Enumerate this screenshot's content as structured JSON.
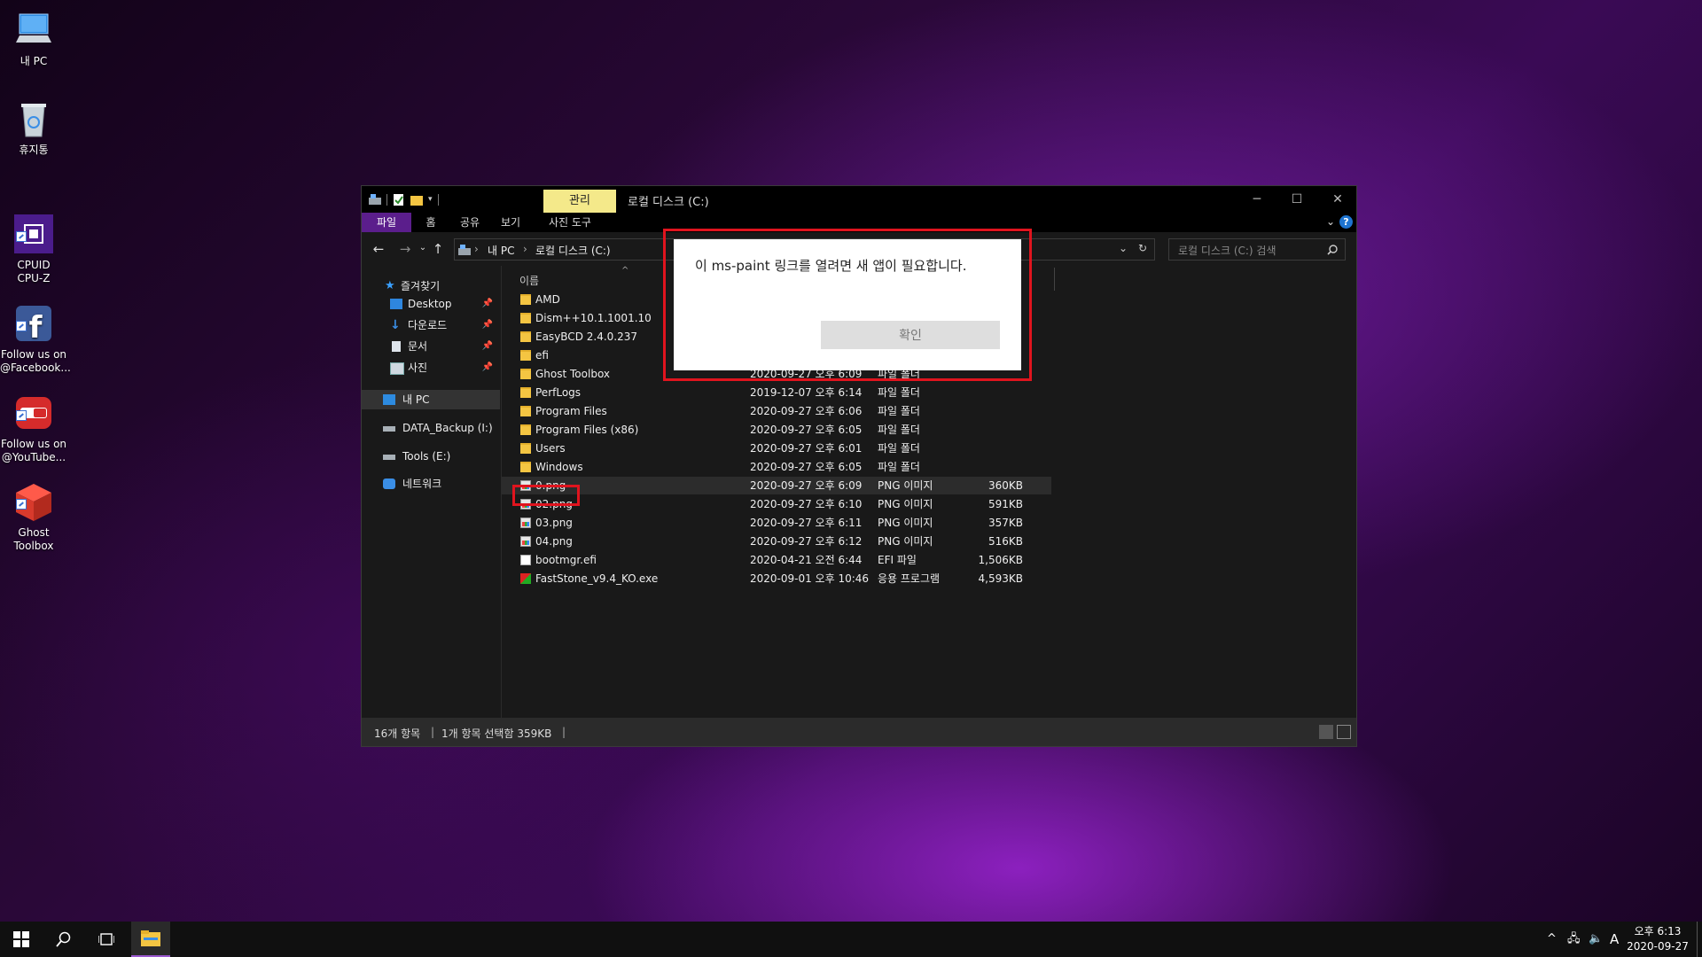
{
  "desktop_icons": [
    {
      "label": "내 PC",
      "icon": "computer-icon"
    },
    {
      "label": "휴지통",
      "icon": "recycle-bin-icon"
    },
    {
      "label": "CPUID\nCPU-Z",
      "icon": "cpuz-icon"
    },
    {
      "label": "Follow us on\n@Facebook...",
      "icon": "facebook-icon"
    },
    {
      "label": "Follow us on\n@YouTube...",
      "icon": "youtube-icon"
    },
    {
      "label": "Ghost\nToolbox",
      "icon": "ghost-toolbox-icon"
    }
  ],
  "explorer": {
    "context_tab": "관리",
    "title": "로컬 디스크 (C:)",
    "ribbon_tabs": [
      "파일",
      "홈",
      "공유",
      "보기",
      "사진 도구"
    ],
    "address": {
      "root": "내 PC",
      "sep": "›",
      "current": "로컬 디스크 (C:)"
    },
    "search_placeholder": "로컬 디스크 (C:) 검색",
    "nav": {
      "quick_access": "즐겨찾기",
      "pinned": [
        "Desktop",
        "다운로드",
        "문서",
        "사진"
      ],
      "this_pc": "내 PC",
      "drives": [
        "DATA_Backup (I:)",
        "Tools (E:)"
      ],
      "network": "네트워크"
    },
    "column_name": "이름",
    "files": [
      {
        "name": "AMD",
        "date": "",
        "type": "",
        "size": "",
        "kind": "folder"
      },
      {
        "name": "Dism++10.1.1001.10",
        "date": "",
        "type": "",
        "size": "",
        "kind": "folder"
      },
      {
        "name": "EasyBCD 2.4.0.237",
        "date": "",
        "type": "",
        "size": "",
        "kind": "folder"
      },
      {
        "name": "efi",
        "date": "",
        "type": "",
        "size": "",
        "kind": "folder"
      },
      {
        "name": "Ghost Toolbox",
        "date": "2020-09-27 오후 6:09",
        "type": "파일 폴더",
        "size": "",
        "kind": "folder"
      },
      {
        "name": "PerfLogs",
        "date": "2019-12-07 오후 6:14",
        "type": "파일 폴더",
        "size": "",
        "kind": "folder"
      },
      {
        "name": "Program Files",
        "date": "2020-09-27 오후 6:06",
        "type": "파일 폴더",
        "size": "",
        "kind": "folder"
      },
      {
        "name": "Program Files (x86)",
        "date": "2020-09-27 오후 6:05",
        "type": "파일 폴더",
        "size": "",
        "kind": "folder"
      },
      {
        "name": "Users",
        "date": "2020-09-27 오후 6:01",
        "type": "파일 폴더",
        "size": "",
        "kind": "folder"
      },
      {
        "name": "Windows",
        "date": "2020-09-27 오후 6:05",
        "type": "파일 폴더",
        "size": "",
        "kind": "folder"
      },
      {
        "name": "0.png",
        "date": "2020-09-27 오후 6:09",
        "type": "PNG 이미지",
        "size": "360KB",
        "kind": "png"
      },
      {
        "name": "02.png",
        "date": "2020-09-27 오후 6:10",
        "type": "PNG 이미지",
        "size": "591KB",
        "kind": "png"
      },
      {
        "name": "03.png",
        "date": "2020-09-27 오후 6:11",
        "type": "PNG 이미지",
        "size": "357KB",
        "kind": "png"
      },
      {
        "name": "04.png",
        "date": "2020-09-27 오후 6:12",
        "type": "PNG 이미지",
        "size": "516KB",
        "kind": "png"
      },
      {
        "name": "bootmgr.efi",
        "date": "2020-04-21 오전 6:44",
        "type": "EFI 파일",
        "size": "1,506KB",
        "kind": "file"
      },
      {
        "name": "FastStone_v9.4_KO.exe",
        "date": "2020-09-01 오후 10:46",
        "type": "응용 프로그램",
        "size": "4,593KB",
        "kind": "exe"
      }
    ],
    "selected_file": "0.png",
    "status": {
      "count": "16개 항목",
      "selection": "1개 항목 선택함 359KB"
    }
  },
  "dialog": {
    "message": "이 ms-paint 링크를 열려면 새 앱이 필요합니다.",
    "ok_label": "확인"
  },
  "taskbar": {
    "clock_time": "오후 6:13",
    "clock_date": "2020-09-27",
    "ime": "A"
  },
  "colors": {
    "accent": "#5b1e8c",
    "context_tab": "#f4e98a",
    "highlight": "#e0141e"
  }
}
